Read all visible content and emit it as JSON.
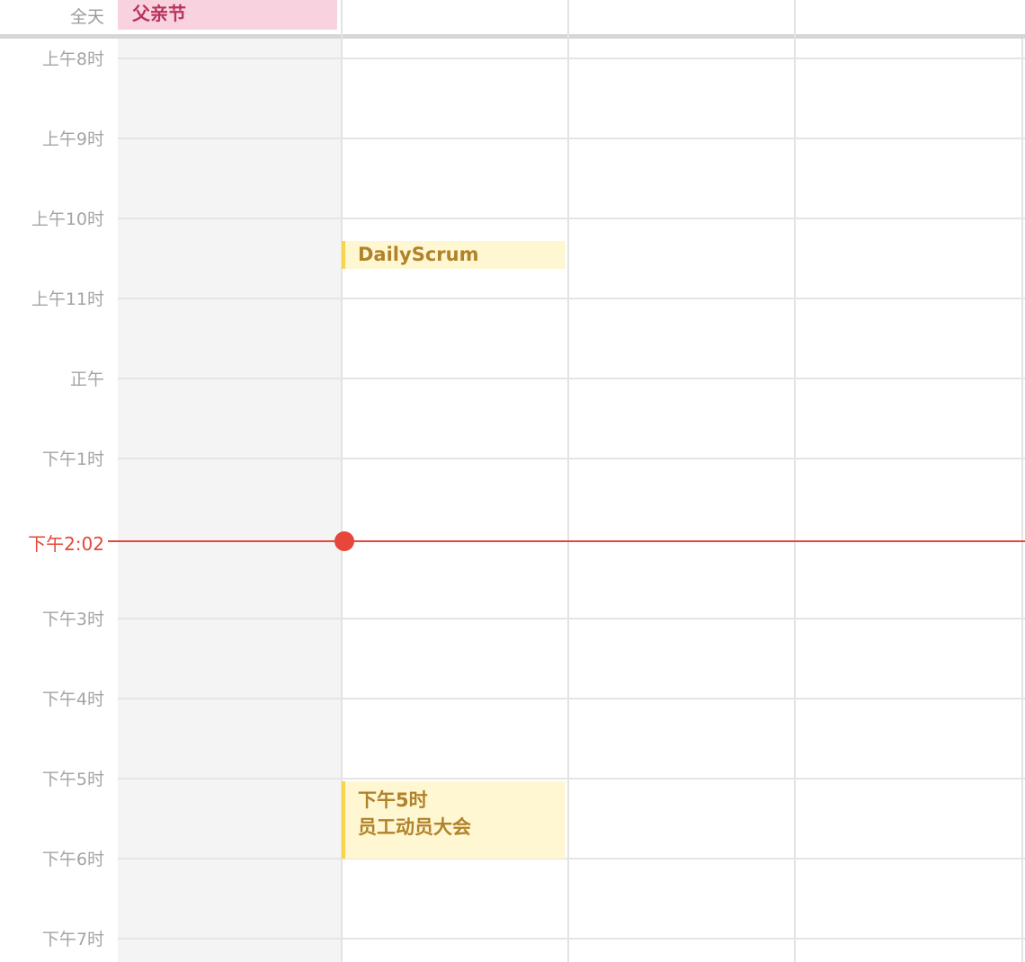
{
  "allday": {
    "label": "全天",
    "events": [
      {
        "title": "父亲节"
      }
    ]
  },
  "hours": [
    "上午8时",
    "上午9时",
    "上午10时",
    "上午11时",
    "正午",
    "下午1时",
    "下午3时",
    "下午4时",
    "下午5时",
    "下午6时",
    "下午7时"
  ],
  "current_time": "下午2:02",
  "events": [
    {
      "title": "DailyScrum"
    },
    {
      "time": "下午5时",
      "title": "员工动员大会"
    }
  ],
  "colors": {
    "allday_event_bg": "#f8d3df",
    "allday_event_text": "#b8335b",
    "event_bg": "#fff7d1",
    "event_accent": "#f6d54c",
    "event_text": "#b0822a",
    "now_indicator": "#e6473a"
  }
}
